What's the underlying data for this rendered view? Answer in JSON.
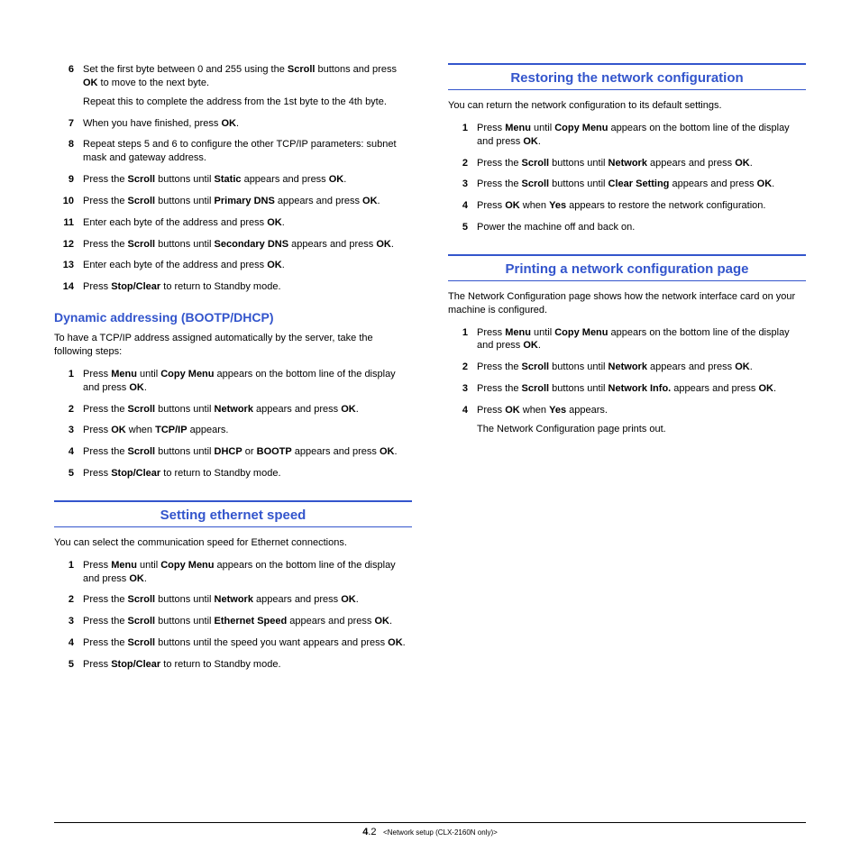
{
  "left": {
    "steps_cont": [
      {
        "n": "6",
        "html": "Set the first byte between 0 and 255 using the <b>Scroll</b> buttons and press <b>OK</b> to move to the next byte.",
        "extra": "Repeat this to complete the address from the 1st byte to the 4th byte."
      },
      {
        "n": "7",
        "html": "When you have finished, press <b>OK</b>."
      },
      {
        "n": "8",
        "html": "Repeat steps 5 and 6 to configure the other TCP/IP parameters: subnet mask and gateway address."
      },
      {
        "n": "9",
        "html": "Press the <b>Scroll</b> buttons until <b>Static</b> appears and press <b>OK</b>."
      },
      {
        "n": "10",
        "html": "Press the <b>Scroll</b> buttons until <b>Primary DNS</b> appears and press <b>OK</b>."
      },
      {
        "n": "11",
        "html": "Enter each byte of the address and press <b>OK</b>."
      },
      {
        "n": "12",
        "html": "Press the <b>Scroll</b> buttons until <b>Secondary DNS</b> appears and press <b>OK</b>."
      },
      {
        "n": "13",
        "html": "Enter each byte of the address and press <b>OK</b>."
      },
      {
        "n": "14",
        "html": "Press <b>Stop/Clear</b> to return to Standby mode."
      }
    ],
    "dyn_heading": "Dynamic addressing (BOOTP/DHCP)",
    "dyn_intro": "To have a TCP/IP address assigned automatically by the server, take the following steps:",
    "dyn_steps": [
      {
        "n": "1",
        "html": "Press <b>Menu</b> until <b>Copy Menu</b> appears on the bottom line of the display and press <b>OK</b>."
      },
      {
        "n": "2",
        "html": "Press the <b>Scroll</b> buttons until <b>Network</b> appears and press <b>OK</b>."
      },
      {
        "n": "3",
        "html": "Press <b>OK</b> when <b>TCP/IP</b> appears."
      },
      {
        "n": "4",
        "html": "Press the <b>Scroll</b> buttons until <b>DHCP</b> or <b>BOOTP</b> appears and press <b>OK</b>."
      },
      {
        "n": "5",
        "html": "Press <b>Stop/Clear</b> to return to Standby mode."
      }
    ],
    "eth_heading": "Setting ethernet speed",
    "eth_intro": "You can select the communication speed for Ethernet connections.",
    "eth_steps": [
      {
        "n": "1",
        "html": "Press <b>Menu</b> until <b>Copy Menu</b> appears on the bottom line of the display and press <b>OK</b>."
      },
      {
        "n": "2",
        "html": "Press the <b>Scroll</b> buttons until <b>Network</b> appears and press <b>OK</b>."
      },
      {
        "n": "3",
        "html": "Press the <b>Scroll</b> buttons until <b>Ethernet Speed</b> appears and press <b>OK</b>."
      },
      {
        "n": "4",
        "html": "Press the <b>Scroll</b> buttons until the speed you want appears and press <b>OK</b>."
      },
      {
        "n": "5",
        "html": "Press <b>Stop/Clear</b> to return to Standby mode."
      }
    ]
  },
  "right": {
    "rest_heading": "Restoring the network configuration",
    "rest_intro": "You can return the network configuration to its default settings.",
    "rest_steps": [
      {
        "n": "1",
        "html": "Press <b>Menu</b> until <b>Copy Menu</b> appears on the bottom line of the display and press <b>OK</b>."
      },
      {
        "n": "2",
        "html": "Press the <b>Scroll</b> buttons until <b>Network</b> appears and press <b>OK</b>."
      },
      {
        "n": "3",
        "html": "Press the <b>Scroll</b> buttons until <b>Clear Setting</b> appears and press <b>OK</b>."
      },
      {
        "n": "4",
        "html": "Press <b>OK</b> when <b>Yes</b> appears to restore the network configuration."
      },
      {
        "n": "5",
        "html": "Power the machine off and back on."
      }
    ],
    "print_heading": "Printing a network configuration page",
    "print_intro": "The Network Configuration page shows how the network interface card on your machine is configured.",
    "print_steps": [
      {
        "n": "1",
        "html": "Press <b>Menu</b> until <b>Copy Menu</b> appears on the bottom line of the display and press <b>OK</b>."
      },
      {
        "n": "2",
        "html": "Press the <b>Scroll</b> buttons until <b>Network</b> appears and press <b>OK</b>."
      },
      {
        "n": "3",
        "html": "Press the <b>Scroll</b> buttons until <b>Network Info.</b> appears and press <b>OK</b>."
      },
      {
        "n": "4",
        "html": "Press <b>OK</b> when <b>Yes</b> appears.",
        "extra": "The Network Configuration page prints out."
      }
    ]
  },
  "footer": {
    "page_major": "4",
    "page_minor": ".2",
    "chapter": "<Network setup (CLX-2160N only)>"
  }
}
